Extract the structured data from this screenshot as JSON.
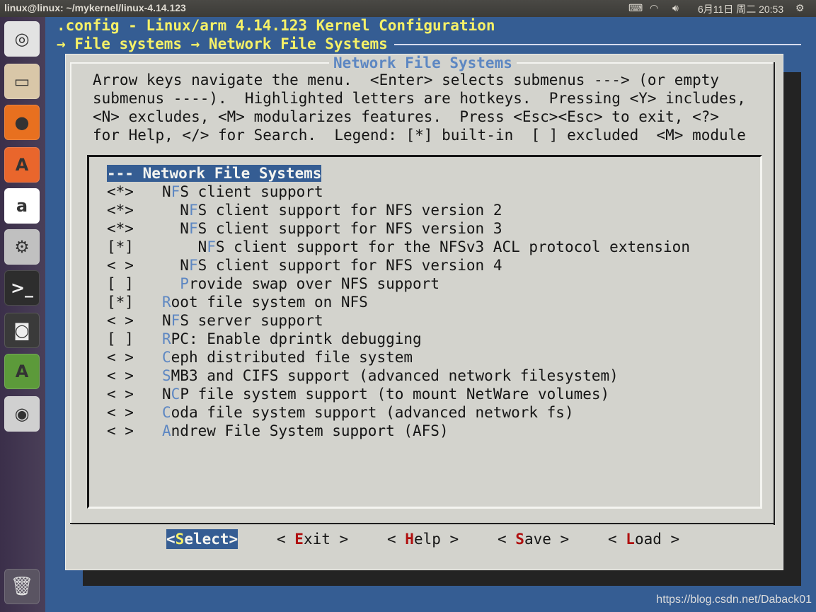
{
  "topbar": {
    "title": "linux@linux: ~/mykernel/linux-4.14.123",
    "datetime": "6月11日 周二 20:53"
  },
  "terminal": {
    "line1": ".config - Linux/arm 4.14.123 Kernel Configuration",
    "line2": "→ File systems → Network File Systems"
  },
  "dialog": {
    "title": "Network File Systems",
    "help": [
      "Arrow keys navigate the menu.  <Enter> selects submenus ---> (or empty",
      "submenus ----).  Highlighted letters are hotkeys.  Pressing <Y> includes,",
      "<N> excludes, <M> modularizes features.  Press <Esc><Esc> to exit, <?>",
      "for Help, </> for Search.  Legend: [*] built-in  [ ] excluded  <M> module"
    ],
    "items": [
      {
        "mark": "",
        "indent": "",
        "pre": "",
        "hotkey": "",
        "rest": "--- Network File Systems"
      },
      {
        "mark": "<*>",
        "indent": "",
        "pre": "N",
        "hotkey": "F",
        "rest": "S client support"
      },
      {
        "mark": "<*>",
        "indent": "  ",
        "pre": "N",
        "hotkey": "F",
        "rest": "S client support for NFS version 2"
      },
      {
        "mark": "<*>",
        "indent": "  ",
        "pre": "N",
        "hotkey": "F",
        "rest": "S client support for NFS version 3"
      },
      {
        "mark": "[*]",
        "indent": "    ",
        "pre": "N",
        "hotkey": "F",
        "rest": "S client support for the NFSv3 ACL protocol extension"
      },
      {
        "mark": "< >",
        "indent": "  ",
        "pre": "N",
        "hotkey": "F",
        "rest": "S client support for NFS version 4"
      },
      {
        "mark": "[ ]",
        "indent": "  ",
        "pre": "",
        "hotkey": "P",
        "rest": "rovide swap over NFS support"
      },
      {
        "mark": "[*]",
        "indent": "",
        "pre": "",
        "hotkey": "R",
        "rest": "oot file system on NFS"
      },
      {
        "mark": "< >",
        "indent": "",
        "pre": "N",
        "hotkey": "F",
        "rest": "S server support"
      },
      {
        "mark": "[ ]",
        "indent": "",
        "pre": "",
        "hotkey": "R",
        "rest": "PC: Enable dprintk debugging"
      },
      {
        "mark": "< >",
        "indent": "",
        "pre": "",
        "hotkey": "C",
        "rest": "eph distributed file system"
      },
      {
        "mark": "< >",
        "indent": "",
        "pre": "",
        "hotkey": "S",
        "rest": "MB3 and CIFS support (advanced network filesystem)"
      },
      {
        "mark": "< >",
        "indent": "",
        "pre": "N",
        "hotkey": "C",
        "rest": "P file system support (to mount NetWare volumes)"
      },
      {
        "mark": "< >",
        "indent": "",
        "pre": "",
        "hotkey": "C",
        "rest": "oda file system support (advanced network fs)"
      },
      {
        "mark": "< >",
        "indent": "",
        "pre": "",
        "hotkey": "A",
        "rest": "ndrew File System support (AFS)"
      }
    ],
    "buttons": [
      {
        "pre": "<",
        "hotkey": "S",
        "rest": "elect>",
        "selected": true
      },
      {
        "pre": "< ",
        "hotkey": "E",
        "rest": "xit >",
        "selected": false
      },
      {
        "pre": "< ",
        "hotkey": "H",
        "rest": "elp >",
        "selected": false
      },
      {
        "pre": "< ",
        "hotkey": "S",
        "rest": "ave >",
        "selected": false
      },
      {
        "pre": "< ",
        "hotkey": "L",
        "rest": "oad >",
        "selected": false
      }
    ]
  },
  "watermark": "https://blog.csdn.net/Daback01",
  "launcher": [
    {
      "icon": "ubuntu-dash-icon",
      "glyph": "◎",
      "color": "#e3e3e3"
    },
    {
      "icon": "file-manager-icon",
      "glyph": "▭",
      "color": "#d9c7a8"
    },
    {
      "icon": "firefox-icon",
      "glyph": "●",
      "color": "#e8701f"
    },
    {
      "icon": "software-center-icon",
      "glyph": "A",
      "color": "#e9662c"
    },
    {
      "icon": "amazon-icon",
      "glyph": "a",
      "color": "#ffffff"
    },
    {
      "icon": "system-settings-icon",
      "glyph": "⚙",
      "color": "#c0c0c0"
    },
    {
      "icon": "terminal-icon",
      "glyph": ">_",
      "color": "#2d2d2d"
    },
    {
      "icon": "safe-icon",
      "glyph": "◙",
      "color": "#3a3a3a"
    },
    {
      "icon": "software-updater-icon",
      "glyph": "A",
      "color": "#5c9a3a"
    },
    {
      "icon": "dvd-icon",
      "glyph": "◉",
      "color": "#d0d0d0"
    }
  ],
  "trash": {
    "icon": "trash-icon",
    "glyph": "🗑"
  }
}
